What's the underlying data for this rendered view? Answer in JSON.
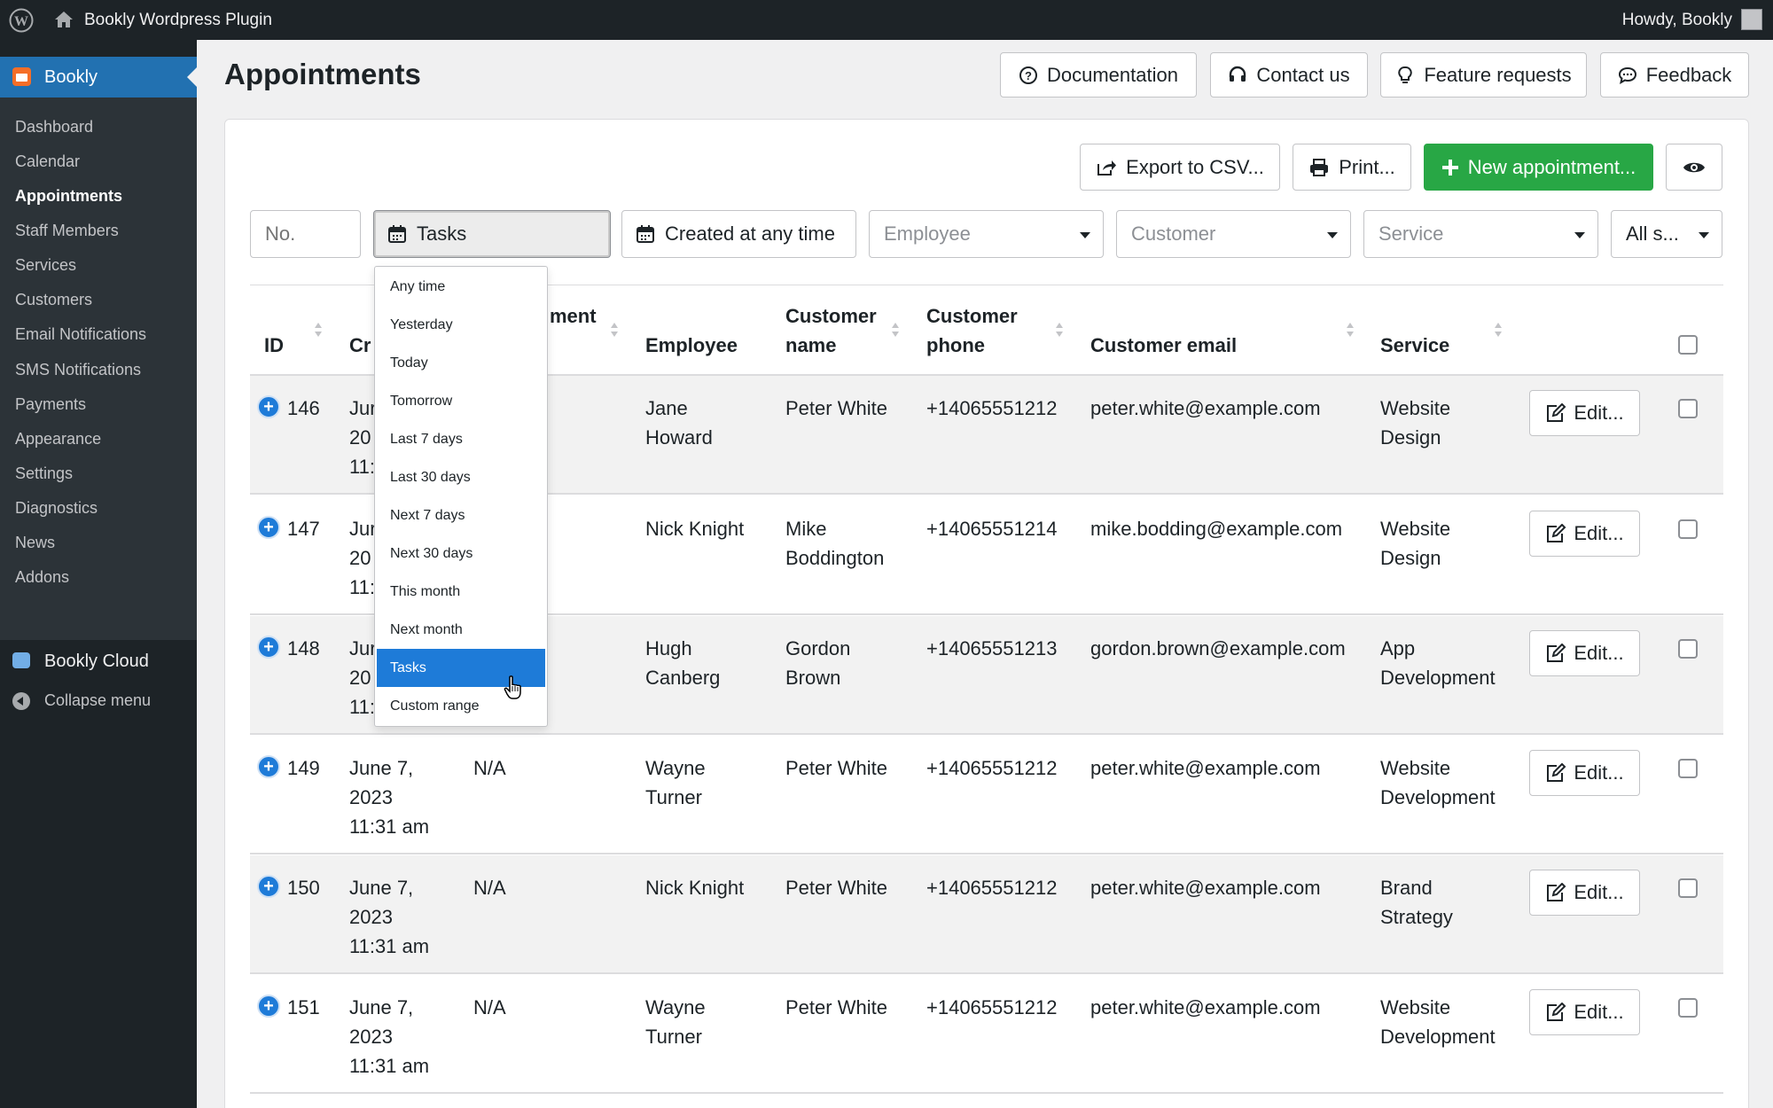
{
  "adminbar": {
    "site_name": "Bookly Wordpress Plugin",
    "howdy": "Howdy, Bookly"
  },
  "sidebar": {
    "brand": "Bookly",
    "items": [
      "Dashboard",
      "Calendar",
      "Appointments",
      "Staff Members",
      "Services",
      "Customers",
      "Email Notifications",
      "SMS Notifications",
      "Payments",
      "Appearance",
      "Settings",
      "Diagnostics",
      "News",
      "Addons"
    ],
    "active": "Appointments",
    "cloud": "Bookly Cloud",
    "collapse": "Collapse menu"
  },
  "header": {
    "title": "Appointments",
    "buttons": [
      "Documentation",
      "Contact us",
      "Feature requests",
      "Feedback"
    ]
  },
  "toolbar": {
    "export": "Export to CSV...",
    "print": "Print...",
    "new": "New appointment..."
  },
  "filters": {
    "no_placeholder": "No.",
    "date": "Tasks",
    "created": "Created at any time",
    "employee": "Employee",
    "customer": "Customer",
    "service": "Service",
    "status": "All s..."
  },
  "columns": {
    "id": "ID",
    "created": "Cr",
    "appointment": "ment",
    "employee": "Employee",
    "customer_name_1": "Customer",
    "customer_name_2": "name",
    "customer_phone_1": "Customer",
    "customer_phone_2": "phone",
    "customer_email": "Customer email",
    "service": "Service"
  },
  "rows": [
    {
      "id": "146",
      "created": [
        "Jur",
        "20",
        "11:"
      ],
      "appt": "",
      "employee": [
        "Jane",
        "Howard"
      ],
      "customer": [
        "Peter White"
      ],
      "phone": "+14065551212",
      "email": "peter.white@example.com",
      "service": [
        "Website",
        "Design"
      ],
      "edit": "Edit..."
    },
    {
      "id": "147",
      "created": [
        "Jur",
        "20",
        "11:"
      ],
      "appt": "",
      "employee": [
        "Nick Knight"
      ],
      "customer": [
        "Mike",
        "Boddington"
      ],
      "phone": "+14065551214",
      "email": "mike.bodding@example.com",
      "service": [
        "Website",
        "Design"
      ],
      "edit": "Edit..."
    },
    {
      "id": "148",
      "created": [
        "Jur",
        "20",
        "11:"
      ],
      "appt": "",
      "employee": [
        "Hugh",
        "Canberg"
      ],
      "customer": [
        "Gordon",
        "Brown"
      ],
      "phone": "+14065551213",
      "email": "gordon.brown@example.com",
      "service": [
        "App",
        "Development"
      ],
      "edit": "Edit..."
    },
    {
      "id": "149",
      "created": [
        "June 7,",
        "2023",
        "11:31 am"
      ],
      "appt": "N/A",
      "employee": [
        "Wayne",
        "Turner"
      ],
      "customer": [
        "Peter White"
      ],
      "phone": "+14065551212",
      "email": "peter.white@example.com",
      "service": [
        "Website",
        "Development"
      ],
      "edit": "Edit..."
    },
    {
      "id": "150",
      "created": [
        "June 7,",
        "2023",
        "11:31 am"
      ],
      "appt": "N/A",
      "employee": [
        "Nick Knight"
      ],
      "customer": [
        "Peter White"
      ],
      "phone": "+14065551212",
      "email": "peter.white@example.com",
      "service": [
        "Brand",
        "Strategy"
      ],
      "edit": "Edit..."
    },
    {
      "id": "151",
      "created": [
        "June 7,",
        "2023",
        "11:31 am"
      ],
      "appt": "N/A",
      "employee": [
        "Wayne",
        "Turner"
      ],
      "customer": [
        "Peter White"
      ],
      "phone": "+14065551212",
      "email": "peter.white@example.com",
      "service": [
        "Website",
        "Development"
      ],
      "edit": "Edit..."
    }
  ],
  "dropdown": {
    "items": [
      "Any time",
      "Yesterday",
      "Today",
      "Tomorrow",
      "Last 7 days",
      "Last 30 days",
      "Next 7 days",
      "Next 30 days",
      "This month",
      "Next month",
      "Tasks",
      "Custom range"
    ],
    "selected": "Tasks"
  },
  "colors": {
    "accent": "#2271b1",
    "success": "#28a745",
    "selected": "#1e7bd8",
    "admin_bg": "#1d2327"
  }
}
